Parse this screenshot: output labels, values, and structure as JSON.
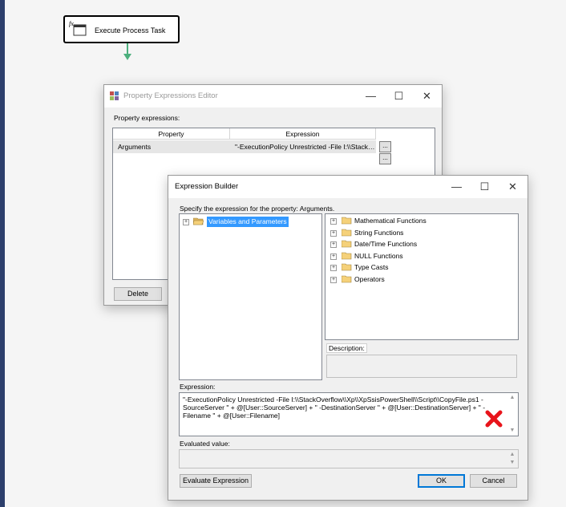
{
  "designer": {
    "task_label": "Execute Process Task"
  },
  "property_editor": {
    "title": "Property Expressions Editor",
    "section_label": "Property expressions:",
    "columns": [
      "Property",
      "Expression"
    ],
    "rows": [
      {
        "property": "Arguments",
        "expression": "\"-ExecutionPolicy Unrestricted -File I:\\\\Stack…"
      }
    ],
    "ellipsis_label": "...",
    "delete_label": "Delete",
    "caption": {
      "minimize": "—",
      "maximize": "☐",
      "close": "✕"
    }
  },
  "expression_builder": {
    "title": "Expression Builder",
    "instruction": "Specify the expression for the property: Arguments.",
    "variables_node": "Variables and Parameters",
    "function_nodes": [
      "Mathematical Functions",
      "String Functions",
      "Date/Time Functions",
      "NULL Functions",
      "Type Casts",
      "Operators"
    ],
    "description_label": "Description:",
    "expression_label": "Expression:",
    "expression_value": "\"-ExecutionPolicy Unrestricted -File I:\\\\StackOverflow\\\\Xp\\\\XpSsisPowerShell\\\\Script\\\\CopyFile.ps1 -SourceServer \" + @[User::SourceServer] + \" -DestinationServer \" + @[User::DestinationServer] + \" -Filename \" +  @[User::Filename]",
    "evaluated_label": "Evaluated value:",
    "evaluate_button": "Evaluate Expression",
    "ok_button": "OK",
    "cancel_button": "Cancel",
    "caption": {
      "minimize": "—",
      "maximize": "☐",
      "close": "✕"
    },
    "error_mark_color": "#e8141b"
  }
}
